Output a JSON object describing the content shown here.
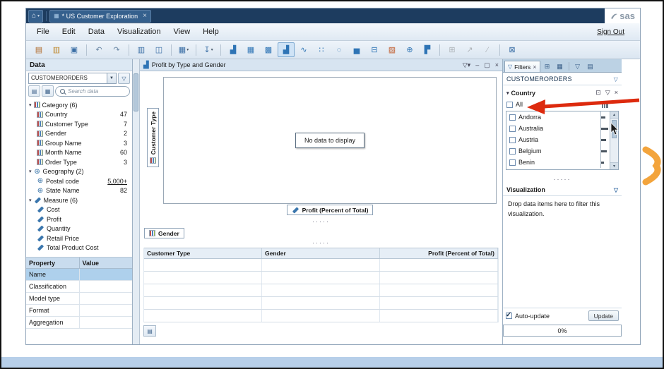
{
  "window": {
    "tab_label": "* US Customer Exploration",
    "tab_close": "×",
    "sas_logo": "sas",
    "sign_out": "Sign Out"
  },
  "menubar": {
    "items": [
      "File",
      "Edit",
      "Data",
      "Visualization",
      "View",
      "Help"
    ]
  },
  "toolbar": {
    "groups": [
      {
        "items": [
          {
            "name": "new-report-icon",
            "glyph": "▤",
            "color": "#b06a2a"
          },
          {
            "name": "open-icon",
            "glyph": "▥",
            "color": "#c08a30"
          },
          {
            "name": "save-icon",
            "glyph": "▣",
            "color": "#3a6ea5"
          }
        ]
      },
      {
        "items": [
          {
            "name": "undo-icon",
            "glyph": "↶",
            "color": "#6a87a5"
          },
          {
            "name": "redo-icon",
            "glyph": "↷",
            "color": "#6a87a5"
          }
        ]
      },
      {
        "items": [
          {
            "name": "duplicate-view-icon",
            "glyph": "▥",
            "color": "#3a6ea5"
          },
          {
            "name": "layout-panels-icon",
            "glyph": "◫",
            "color": "#3a6ea5"
          }
        ]
      },
      {
        "items": [
          {
            "name": "data-table-menu-icon",
            "glyph": "▦",
            "color": "#3a6ea5",
            "dropdown": true
          }
        ]
      },
      {
        "items": [
          {
            "name": "export-menu-icon",
            "glyph": "↧",
            "color": "#3a6ea5",
            "dropdown": true
          }
        ]
      },
      {
        "items": [
          {
            "name": "auto-chart-icon",
            "glyph": "▟",
            "color": "#2e74b5"
          },
          {
            "name": "table-icon",
            "glyph": "▦",
            "color": "#2e74b5"
          },
          {
            "name": "crosstab-icon",
            "glyph": "▩",
            "color": "#2e74b5"
          },
          {
            "name": "bar-chart-icon",
            "glyph": "▟",
            "color": "#2e74b5",
            "selected": true
          },
          {
            "name": "line-chart-icon",
            "glyph": "∿",
            "color": "#2e74b5"
          },
          {
            "name": "scatter-plot-icon",
            "glyph": "∷",
            "color": "#2e74b5"
          },
          {
            "name": "bubble-plot-icon",
            "glyph": "◌",
            "color": "#2e74b5"
          },
          {
            "name": "histogram-icon",
            "glyph": "▅",
            "color": "#2e74b5"
          },
          {
            "name": "box-plot-icon",
            "glyph": "⊟",
            "color": "#2e74b5"
          },
          {
            "name": "heat-map-icon",
            "glyph": "▨",
            "color": "#c05a2a"
          },
          {
            "name": "geo-map-icon",
            "glyph": "⊕",
            "color": "#2e74b5"
          },
          {
            "name": "treemap-icon",
            "glyph": "▛",
            "color": "#2e74b5"
          }
        ]
      },
      {
        "items": [
          {
            "name": "correlation-icon",
            "glyph": "⊞",
            "color": "#555555",
            "disabled": true
          },
          {
            "name": "forecast-icon",
            "glyph": "↗",
            "color": "#555555",
            "disabled": true
          },
          {
            "name": "fit-line-icon",
            "glyph": "⁄",
            "color": "#555555",
            "disabled": true
          }
        ]
      },
      {
        "items": [
          {
            "name": "comments-icon",
            "glyph": "⊠",
            "color": "#3a6ea5"
          }
        ]
      }
    ]
  },
  "data_panel": {
    "title": "Data",
    "source": "CUSTOMERORDERS",
    "search_placeholder": "Search data",
    "groups": [
      {
        "label": "Category (6)",
        "icon": "category",
        "items": [
          {
            "label": "Country",
            "count": "47",
            "icon": "category"
          },
          {
            "label": "Customer Type",
            "count": "7",
            "icon": "category"
          },
          {
            "label": "Gender",
            "count": "2",
            "icon": "category"
          },
          {
            "label": "Group Name",
            "count": "3",
            "icon": "category"
          },
          {
            "label": "Month Name",
            "count": "60",
            "icon": "category"
          },
          {
            "label": "Order Type",
            "count": "3",
            "icon": "category"
          }
        ]
      },
      {
        "label": "Geography (2)",
        "icon": "geography",
        "items": [
          {
            "label": "Postal code",
            "count": "5,000+",
            "icon": "geography",
            "count_underline": true
          },
          {
            "label": "State Name",
            "count": "82",
            "icon": "geography"
          }
        ]
      },
      {
        "label": "Measure (6)",
        "icon": "measure",
        "items": [
          {
            "label": "Cost",
            "count": "",
            "icon": "measure"
          },
          {
            "label": "Profit",
            "count": "",
            "icon": "measure"
          },
          {
            "label": "Quantity",
            "count": "",
            "icon": "measure"
          },
          {
            "label": "Retail Price",
            "count": "",
            "icon": "measure"
          },
          {
            "label": "Total Product Cost",
            "count": "",
            "icon": "measure"
          }
        ]
      }
    ],
    "properties": {
      "headers": [
        "Property",
        "Value"
      ],
      "rows": [
        {
          "property": "Name",
          "value": "",
          "selected": true
        },
        {
          "property": "Classification",
          "value": ""
        },
        {
          "property": "Model type",
          "value": ""
        },
        {
          "property": "Format",
          "value": ""
        },
        {
          "property": "Aggregation",
          "value": ""
        }
      ]
    }
  },
  "viz_panel": {
    "title": "Profit by Type and Gender",
    "no_data_message": "No data to display",
    "y_axis_label": "Customer Type",
    "x_axis_label": "Profit (Percent of Total)",
    "gender_label": "Gender",
    "table_headers": [
      "Customer Type",
      "Gender",
      "Profit (Percent of Total)"
    ],
    "empty_row_count": 5
  },
  "filters_panel": {
    "tab_label": "Filters",
    "source": "CUSTOMERORDERS",
    "filter_name": "Country",
    "all_label": "All",
    "countries": [
      {
        "label": "Andorra",
        "checked": false,
        "freq": 6
      },
      {
        "label": "Australia",
        "checked": false,
        "freq": 10
      },
      {
        "label": "Austria",
        "checked": false,
        "freq": 7
      },
      {
        "label": "Belgium",
        "checked": false,
        "freq": 8
      },
      {
        "label": "Benin",
        "checked": false,
        "freq": 4
      }
    ],
    "visualization_title": "Visualization",
    "visualization_hint": "Drop data items here to filter this visualization.",
    "auto_update_label": "Auto-update",
    "auto_update_checked": true,
    "update_button": "Update",
    "progress": "0%"
  },
  "ui": {
    "splitter_dots": "·····"
  },
  "colors": {
    "annotation_red": "#dd2a0e",
    "logo_orange": "#f3a43c",
    "banner_navy": "#1d3c5f",
    "selection_blue": "#aed0ec"
  }
}
